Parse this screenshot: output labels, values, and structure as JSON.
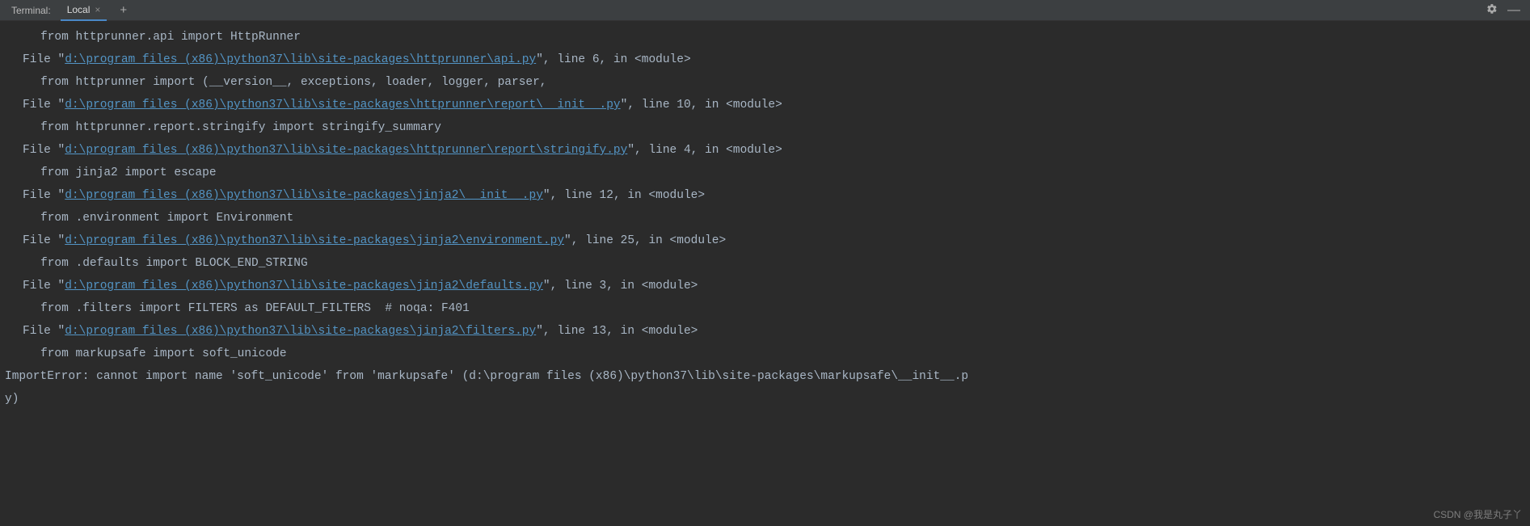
{
  "header": {
    "label": "Terminal:",
    "tab": {
      "name": "Local"
    }
  },
  "watermark": "CSDN @我是丸子丫",
  "lines": [
    {
      "type": "plain",
      "indent": 2,
      "text": "from httprunner.api import HttpRunner"
    },
    {
      "type": "file",
      "indent": 1,
      "path": "d:\\program files (x86)\\python37\\lib\\site-packages\\httprunner\\api.py",
      "lineNo": "6",
      "loc": "<module>"
    },
    {
      "type": "plain",
      "indent": 2,
      "text": "from httprunner import (__version__, exceptions, loader, logger, parser,"
    },
    {
      "type": "file",
      "indent": 1,
      "path": "d:\\program files (x86)\\python37\\lib\\site-packages\\httprunner\\report\\__init__.py",
      "lineNo": "10",
      "loc": "<module>"
    },
    {
      "type": "plain",
      "indent": 2,
      "text": "from httprunner.report.stringify import stringify_summary"
    },
    {
      "type": "file",
      "indent": 1,
      "path": "d:\\program files (x86)\\python37\\lib\\site-packages\\httprunner\\report\\stringify.py",
      "lineNo": "4",
      "loc": "<module>"
    },
    {
      "type": "plain",
      "indent": 2,
      "text": "from jinja2 import escape"
    },
    {
      "type": "file",
      "indent": 1,
      "path": "d:\\program files (x86)\\python37\\lib\\site-packages\\jinja2\\__init__.py",
      "lineNo": "12",
      "loc": "<module>"
    },
    {
      "type": "plain",
      "indent": 2,
      "text": "from .environment import Environment"
    },
    {
      "type": "file",
      "indent": 1,
      "path": "d:\\program files (x86)\\python37\\lib\\site-packages\\jinja2\\environment.py",
      "lineNo": "25",
      "loc": "<module>"
    },
    {
      "type": "plain",
      "indent": 2,
      "text": "from .defaults import BLOCK_END_STRING"
    },
    {
      "type": "file",
      "indent": 1,
      "path": "d:\\program files (x86)\\python37\\lib\\site-packages\\jinja2\\defaults.py",
      "lineNo": "3",
      "loc": "<module>"
    },
    {
      "type": "plain",
      "indent": 2,
      "text": "from .filters import FILTERS as DEFAULT_FILTERS  # noqa: F401"
    },
    {
      "type": "file",
      "indent": 1,
      "path": "d:\\program files (x86)\\python37\\lib\\site-packages\\jinja2\\filters.py",
      "lineNo": "13",
      "loc": "<module>"
    },
    {
      "type": "plain",
      "indent": 2,
      "text": "from markupsafe import soft_unicode"
    },
    {
      "type": "error",
      "indent": 0,
      "text": "ImportError: cannot import name 'soft_unicode' from 'markupsafe' (d:\\program files (x86)\\python37\\lib\\site-packages\\markupsafe\\__init__.p"
    },
    {
      "type": "error",
      "indent": 0,
      "text": "y)"
    }
  ]
}
